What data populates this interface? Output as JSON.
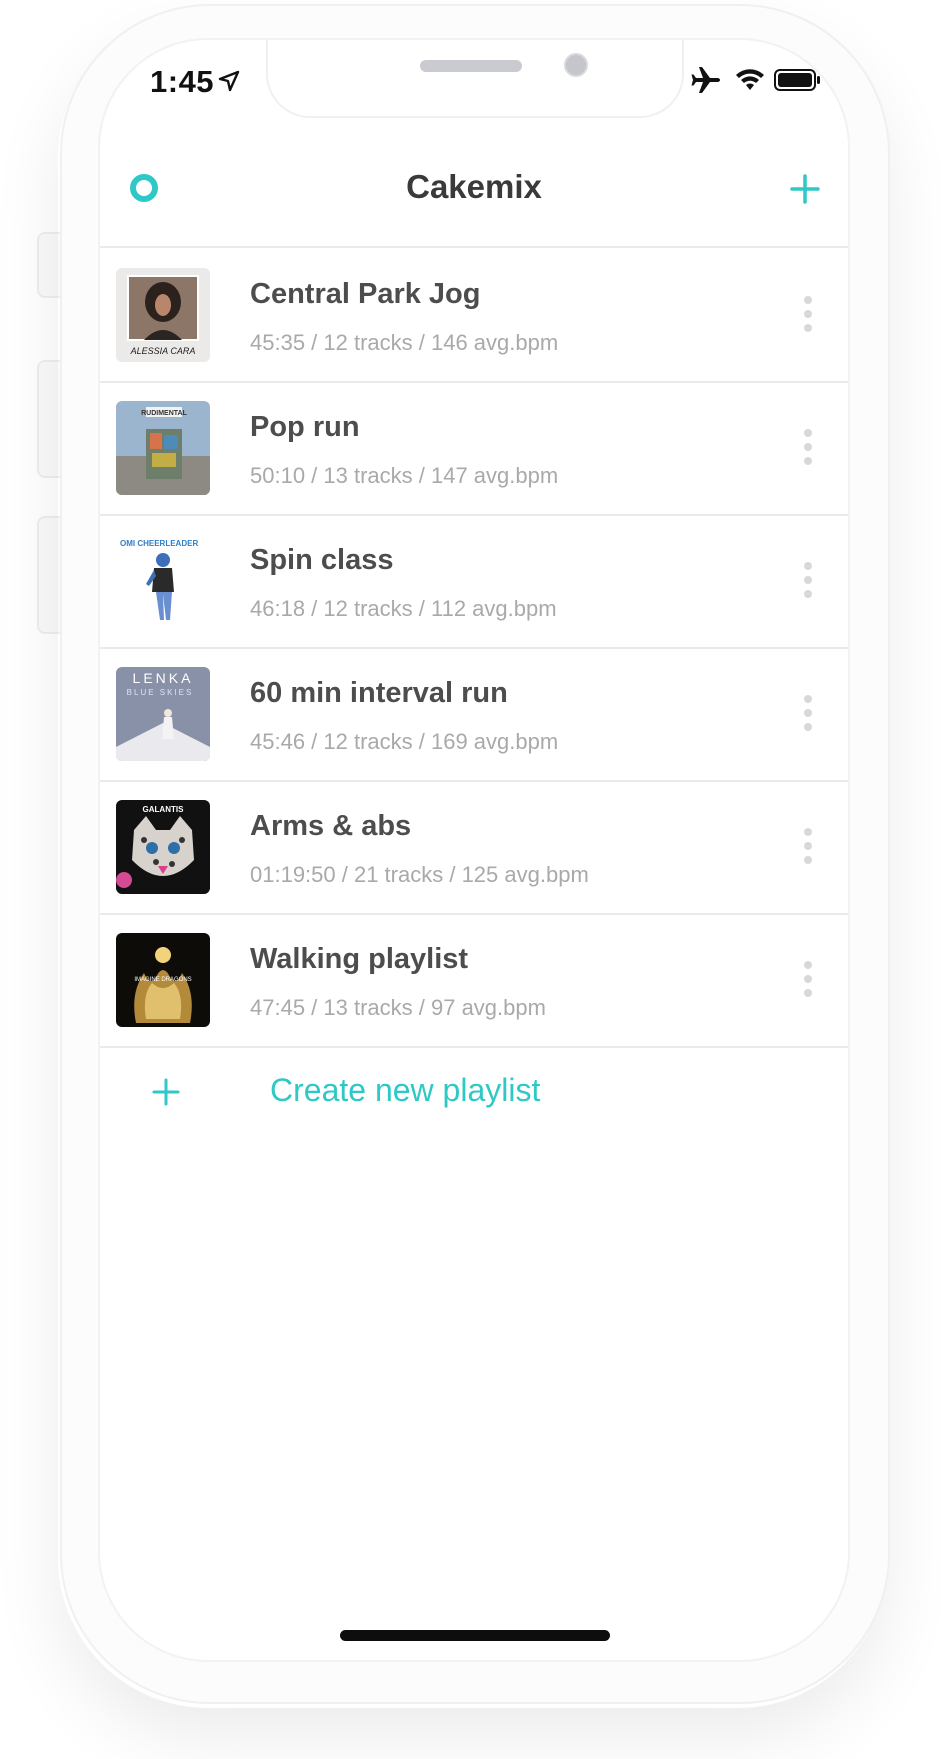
{
  "status_bar": {
    "time": "1:45",
    "icons": [
      "location-arrow-icon",
      "airplane-icon",
      "wifi-icon",
      "battery-icon"
    ]
  },
  "header": {
    "title": "Cakemix",
    "left_icon": "circle-icon",
    "right_icon": "plus-icon"
  },
  "playlists": [
    {
      "title": "Central Park Jog",
      "meta": "45:35 / 12 tracks / 146 avg.bpm",
      "cover_text": "ALESSIA CARA"
    },
    {
      "title": "Pop run",
      "meta": "50:10 / 13 tracks / 147 avg.bpm",
      "cover_text": "RUDIMENTAL"
    },
    {
      "title": "Spin class",
      "meta": "46:18 / 12 tracks / 112 avg.bpm",
      "cover_text": "OMI CHEERLEADER"
    },
    {
      "title": "60 min interval run",
      "meta": "45:46 / 12 tracks / 169 avg.bpm",
      "cover_text": "LENKA"
    },
    {
      "title": "Arms & abs",
      "meta": "01:19:50 / 21 tracks / 125 avg.bpm",
      "cover_text": "GALANTIS"
    },
    {
      "title": "Walking playlist",
      "meta": "47:45 / 13 tracks / 97 avg.bpm",
      "cover_text": "IMAGINE DRAGONS"
    }
  ],
  "create": {
    "label": "Create new playlist"
  },
  "colors": {
    "accent": "#2ec9c7",
    "title": "#3a3a3a",
    "meta": "#a9a9a9"
  }
}
